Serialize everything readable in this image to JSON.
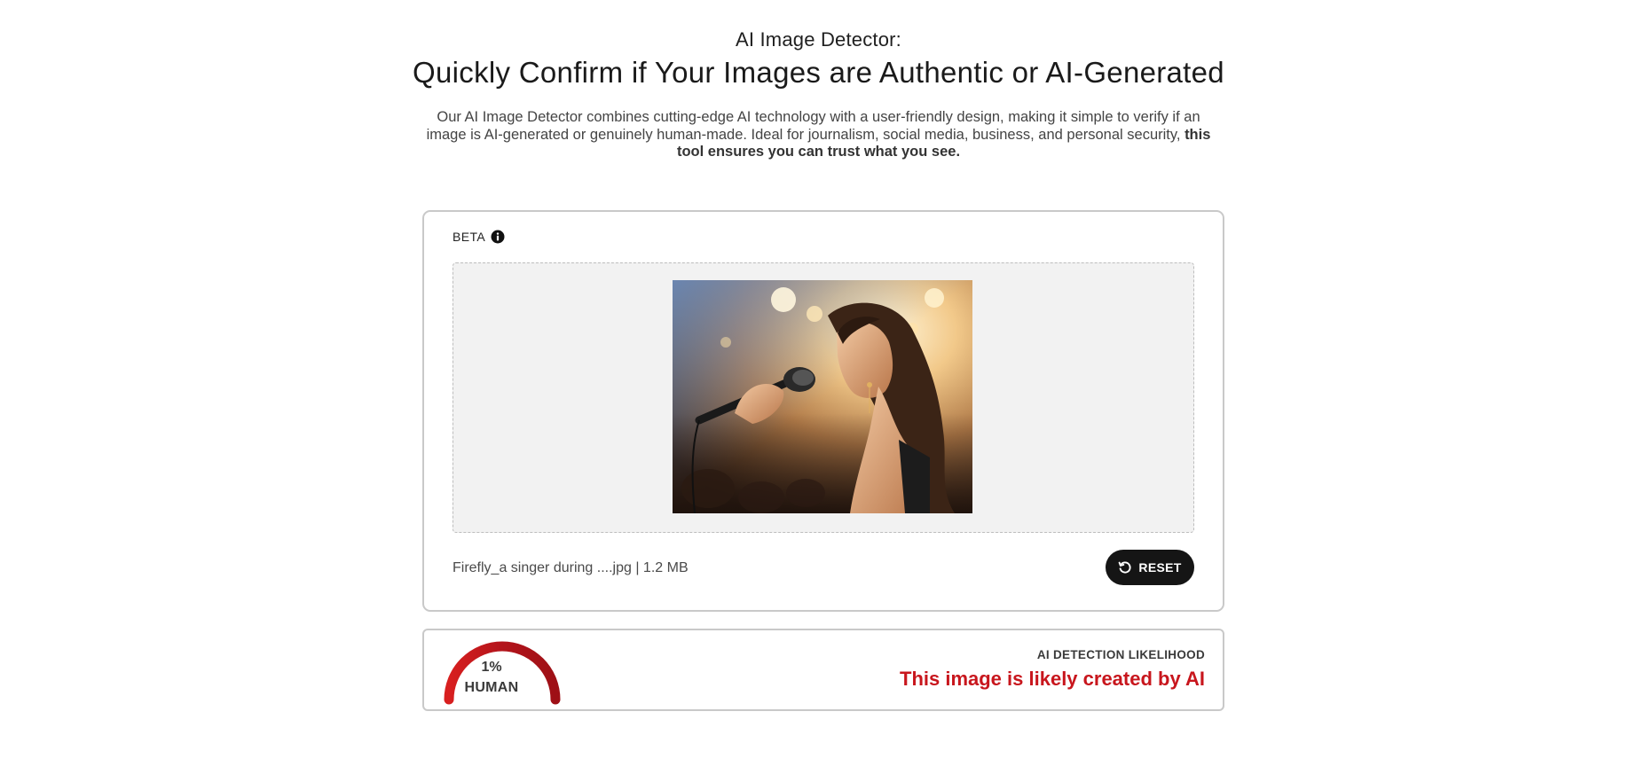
{
  "header": {
    "eyebrow": "AI Image Detector:",
    "title": "Quickly Confirm if Your Images are Authentic or AI-Generated",
    "intro_text": "Our AI Image Detector combines cutting-edge AI technology with a user-friendly design, making it simple to verify if an image is AI-generated or genuinely human-made. Ideal for journalism, social media, business, and personal security, ",
    "intro_bold": "this tool ensures you can trust what you see."
  },
  "upload_card": {
    "beta_label": "BETA",
    "beta_icon": "info-icon",
    "preview_description": "Photo of a woman singing into a microphone on a stage with warm spotlights",
    "file_info": "Firefly_a singer during ....jpg | 1.2 MB",
    "reset_label": "RESET",
    "reset_icon": "reset-icon"
  },
  "result": {
    "gauge_percent": "1%",
    "gauge_percent_value": 1,
    "gauge_label": "HUMAN",
    "likelihood_label": "AI DETECTION LIKELIHOOD",
    "verdict": "This image is likely created by AI",
    "verdict_color": "#c8161d"
  },
  "colors": {
    "button_bg": "#151515",
    "gauge_red": "#c8161d",
    "border": "#c9c9c9",
    "dropzone_bg": "#f2f2f2"
  }
}
